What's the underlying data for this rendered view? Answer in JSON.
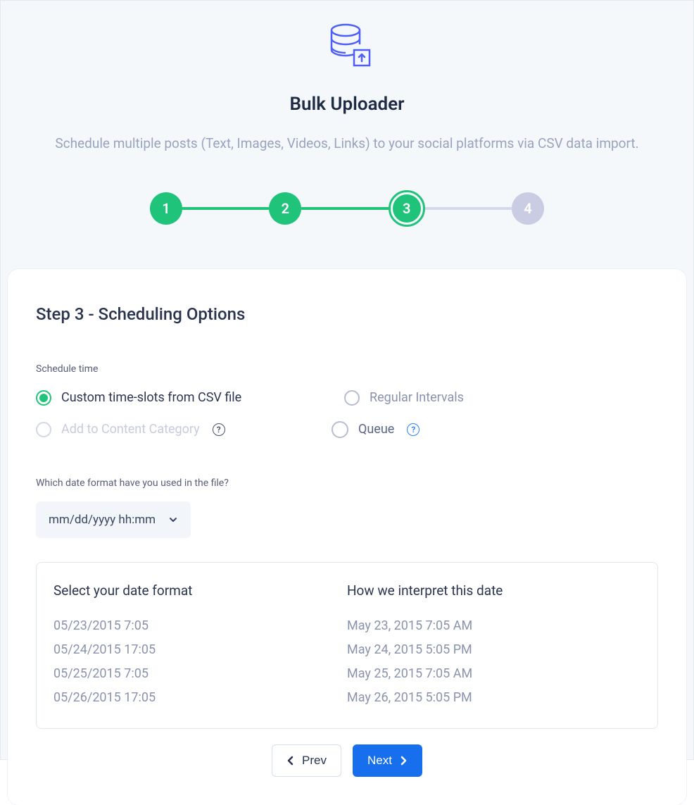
{
  "header": {
    "title": "Bulk Uploader",
    "subtitle": "Schedule multiple posts (Text, Images, Videos, Links) to your social platforms via CSV data import."
  },
  "stepper": {
    "steps": [
      "1",
      "2",
      "3",
      "4"
    ],
    "current_index": 2
  },
  "card": {
    "heading": "Step 3 - Scheduling Options",
    "schedule_label": "Schedule time",
    "radios": {
      "custom_csv": "Custom time-slots from CSV file",
      "regular_intervals": "Regular Intervals",
      "content_category": "Add to Content Category",
      "queue": "Queue"
    },
    "format_question": "Which date format have you used in the file?",
    "format_selected": "mm/dd/yyyy hh:mm",
    "preview": {
      "left_title": "Select your date format",
      "right_title": "How we interpret this date",
      "rows": [
        {
          "raw": "05/23/2015 7:05",
          "interpreted": "May 23, 2015 7:05 AM"
        },
        {
          "raw": "05/24/2015 17:05",
          "interpreted": "May 24, 2015 5:05 PM"
        },
        {
          "raw": "05/25/2015 7:05",
          "interpreted": "May 25, 2015 7:05 AM"
        },
        {
          "raw": "05/26/2015 17:05",
          "interpreted": "May 26, 2015 5:05 PM"
        }
      ]
    }
  },
  "footer": {
    "prev": "Prev",
    "next": "Next"
  },
  "colors": {
    "accent_green": "#1fc37a",
    "accent_blue": "#176fee",
    "muted_purple": "#c9cce3"
  }
}
